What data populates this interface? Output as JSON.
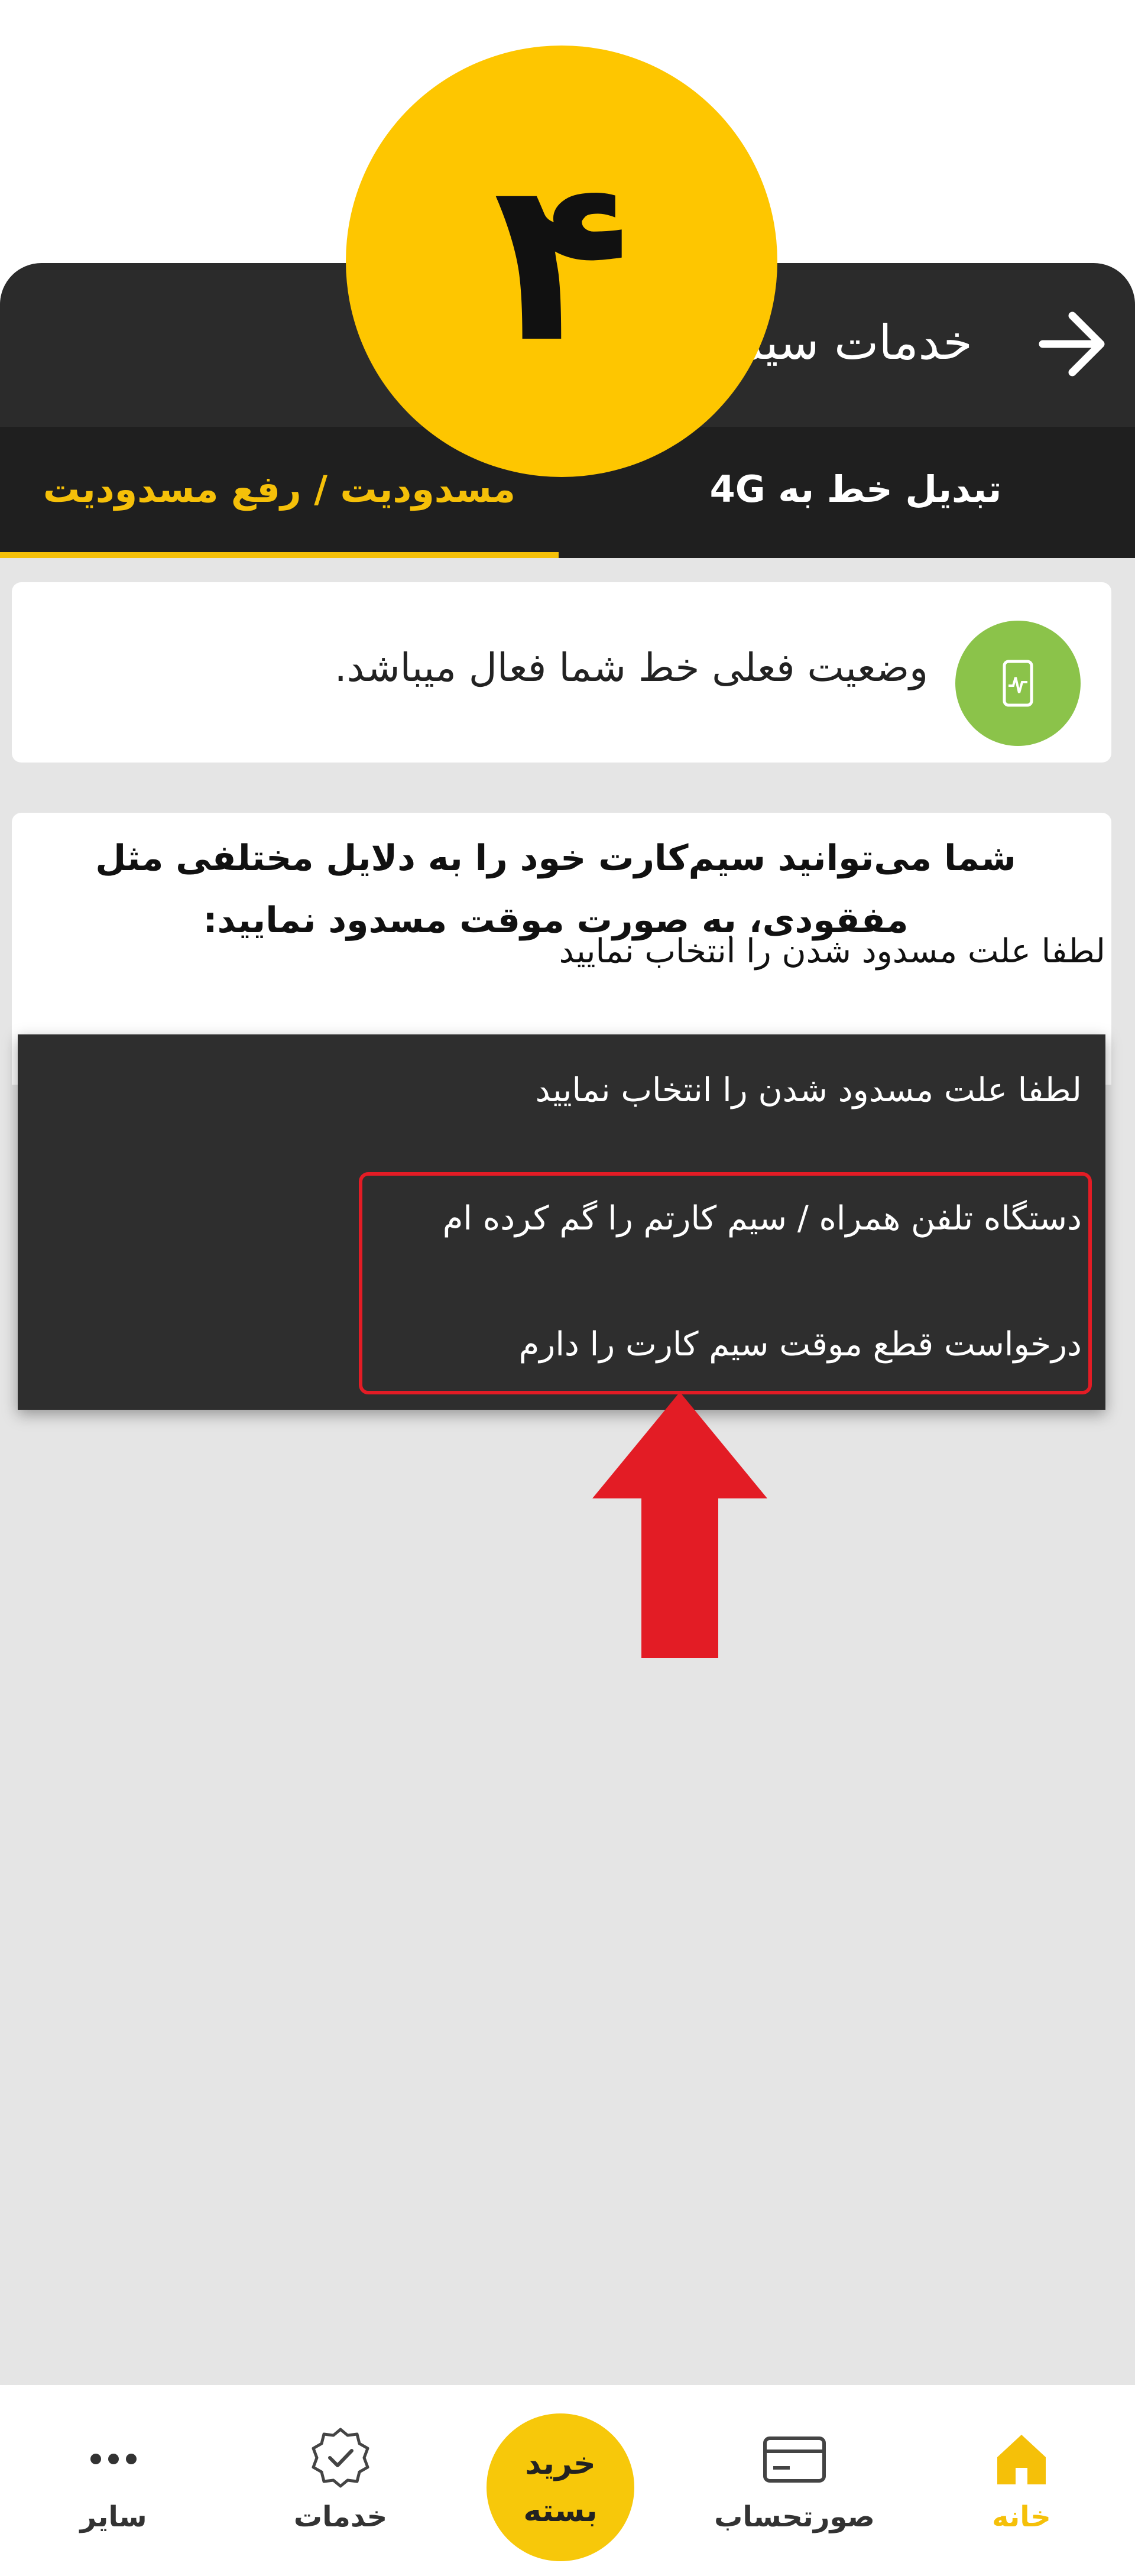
{
  "step_badge": {
    "label": "۴"
  },
  "header": {
    "title": "خدمات سیم‌کارت"
  },
  "tabs": [
    {
      "label": "تبدیل خط به 4G",
      "active": false
    },
    {
      "label": "مسدودیت / رفع مسدودیت",
      "active": true
    }
  ],
  "status": {
    "text": "وضعیت فعلی خط شما فعال میباشد."
  },
  "info": {
    "text": "شما می‌توانید سیم‌کارت خود را به دلایل مختلفی مثل مفقودی، به صورت موقت مسدود نمایید:",
    "select_label": "لطفا علت مسدود شدن را انتخاب نمایید"
  },
  "dropdown": {
    "options": [
      "لطفا علت مسدود شدن را انتخاب نمایید",
      "دستگاه تلفن همراه / سیم کارتم را گم کرده ام",
      "درخواست قطع موقت سیم کارت را دارم"
    ]
  },
  "bottom_nav": {
    "home": "خانه",
    "bill": "صورتحساب",
    "buy_line1": "خرید",
    "buy_line2": "بسته",
    "services": "خدمات",
    "more": "سایر"
  },
  "colors": {
    "accent": "#f5c009",
    "topbar": "#2b2b2b",
    "dropdown": "#2e2e2e",
    "highlight": "#e31c25",
    "status_icon": "#8bc34a"
  }
}
